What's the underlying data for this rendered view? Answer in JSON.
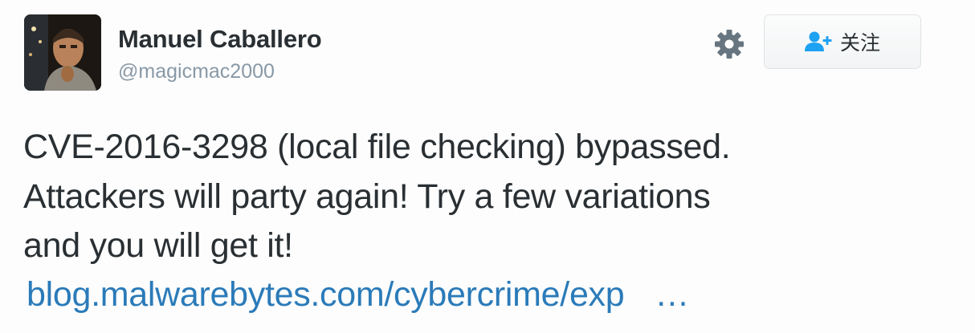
{
  "user": {
    "name": "Manuel Caballero",
    "handle": "@magicmac2000",
    "avatar_icon": "profile-photo"
  },
  "actions": {
    "settings_icon": "gear-icon",
    "follow_label": "关注",
    "follow_icon": "user-plus-icon"
  },
  "tweet": {
    "text_lines": [
      "CVE-2016-3298 (local file checking) bypassed.",
      "Attackers will party again! Try a few variations",
      "and you will get it!"
    ],
    "link_text": "blog.malwarebytes.com/cybercrime/exp",
    "link_ellipsis": "…"
  },
  "colors": {
    "text": "#292f33",
    "secondary": "#8899a6",
    "link": "#2b7bb9",
    "icon": "#66757f",
    "follow_icon": "#1da1f2"
  }
}
